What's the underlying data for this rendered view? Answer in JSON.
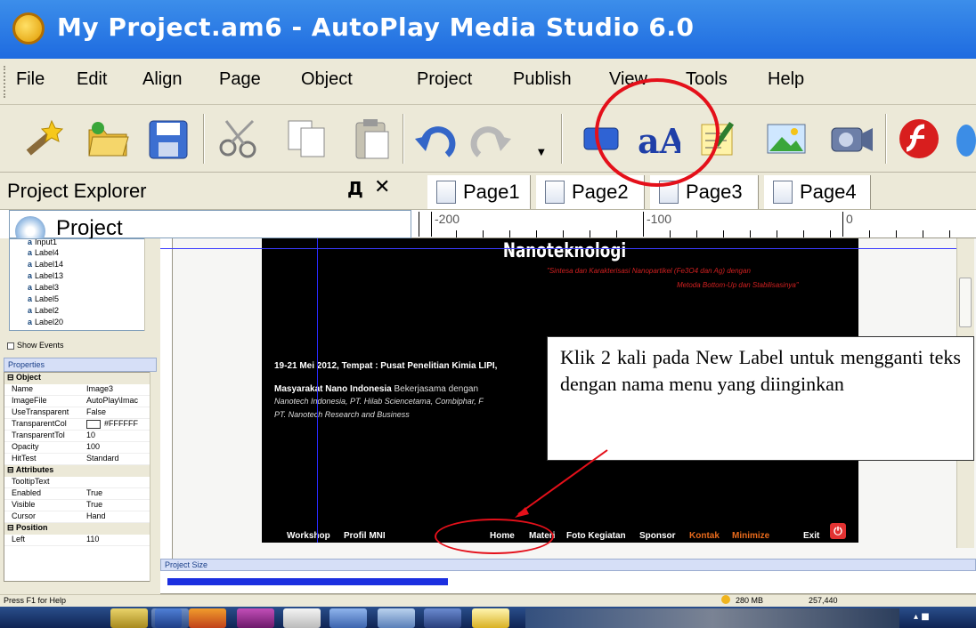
{
  "window": {
    "title": "My Project.am6 - AutoPlay Media Studio 6.0"
  },
  "menu": [
    "File",
    "Edit",
    "Align",
    "Page",
    "Object",
    "Project",
    "Publish",
    "View",
    "Tools",
    "Help"
  ],
  "toolbar": [
    "wand-icon",
    "open-folder-icon",
    "save-icon",
    "cut-icon",
    "copy-icon",
    "paste-icon",
    "undo-icon",
    "redo-icon",
    "button-object-icon",
    "label-object-icon",
    "paragraph-object-icon",
    "image-object-icon",
    "video-object-icon",
    "flash-object-icon"
  ],
  "project_explorer": {
    "title": "Project Explorer",
    "pin": "Д",
    "close": "✕",
    "root": "Project"
  },
  "tabs": [
    "Page1",
    "Page2",
    "Page3",
    "Page4"
  ],
  "ruler": [
    "-200",
    "-100",
    "0"
  ],
  "tree_items": [
    "Input1",
    "Label4",
    "Label14",
    "Label13",
    "Label3",
    "Label5",
    "Label2",
    "Label20"
  ],
  "show_events": "Show Events",
  "properties": {
    "title": "Properties",
    "groups": [
      {
        "name": "Object",
        "rows": [
          [
            "Name",
            "Image3"
          ],
          [
            "ImageFile",
            "AutoPlay\\Imac"
          ],
          [
            "UseTransparent",
            "False"
          ],
          [
            "TransparentCol",
            "#FFFFFF"
          ],
          [
            "TransparentTol",
            "10"
          ],
          [
            "Opacity",
            "100"
          ],
          [
            "HitTest",
            "Standard"
          ]
        ]
      },
      {
        "name": "Attributes",
        "rows": [
          [
            "TooltipText",
            ""
          ],
          [
            "Enabled",
            "True"
          ],
          [
            "Visible",
            "True"
          ],
          [
            "Cursor",
            "Hand"
          ]
        ]
      },
      {
        "name": "Position",
        "rows": [
          [
            "Left",
            "110"
          ]
        ]
      }
    ]
  },
  "design": {
    "title": "Nanoteknologi",
    "subtitle1": "\"Sintesa dan Karakterisasi Nanopartikel (Fe3O4 dan Ag) dengan",
    "subtitle2": "Metoda Bottom-Up dan Stabilisasinya\"",
    "event_line": "19-21 Mei 2012, Tempat  :  Pusat Penelitian Kimia LIPI,",
    "mni_bold": "Masyarakat  Nano Indonesia",
    "mni_rest": " Bekerjasama dengan",
    "partners1": "Nanotech Indonesia, PT. Hilab Sciencetama, Combiphar, F",
    "partners2": "PT. Nanotech Research and Business",
    "nav": {
      "workshop": "Workshop",
      "profil": "Profil MNI",
      "home": "Home",
      "materi": "Materi",
      "foto": "Foto Kegiatan",
      "sponsor": "Sponsor",
      "kontak": "Kontak",
      "minimize": "Minimize",
      "exit": "Exit"
    }
  },
  "callout": "Klik 2 kali pada New Label untuk mengganti teks dengan nama menu yang diinginkan",
  "project_size": {
    "title": "Project Size",
    "fraction": 0.35
  },
  "status": {
    "help": "Press F1 for Help",
    "size": "280 MB",
    "count": "257,440"
  },
  "colors": {
    "title_bar": "#2a7ae4",
    "annotation_red": "#e4101a",
    "kontak_orange": "#e86a1c",
    "fill_blue": "#1b2fe0"
  }
}
